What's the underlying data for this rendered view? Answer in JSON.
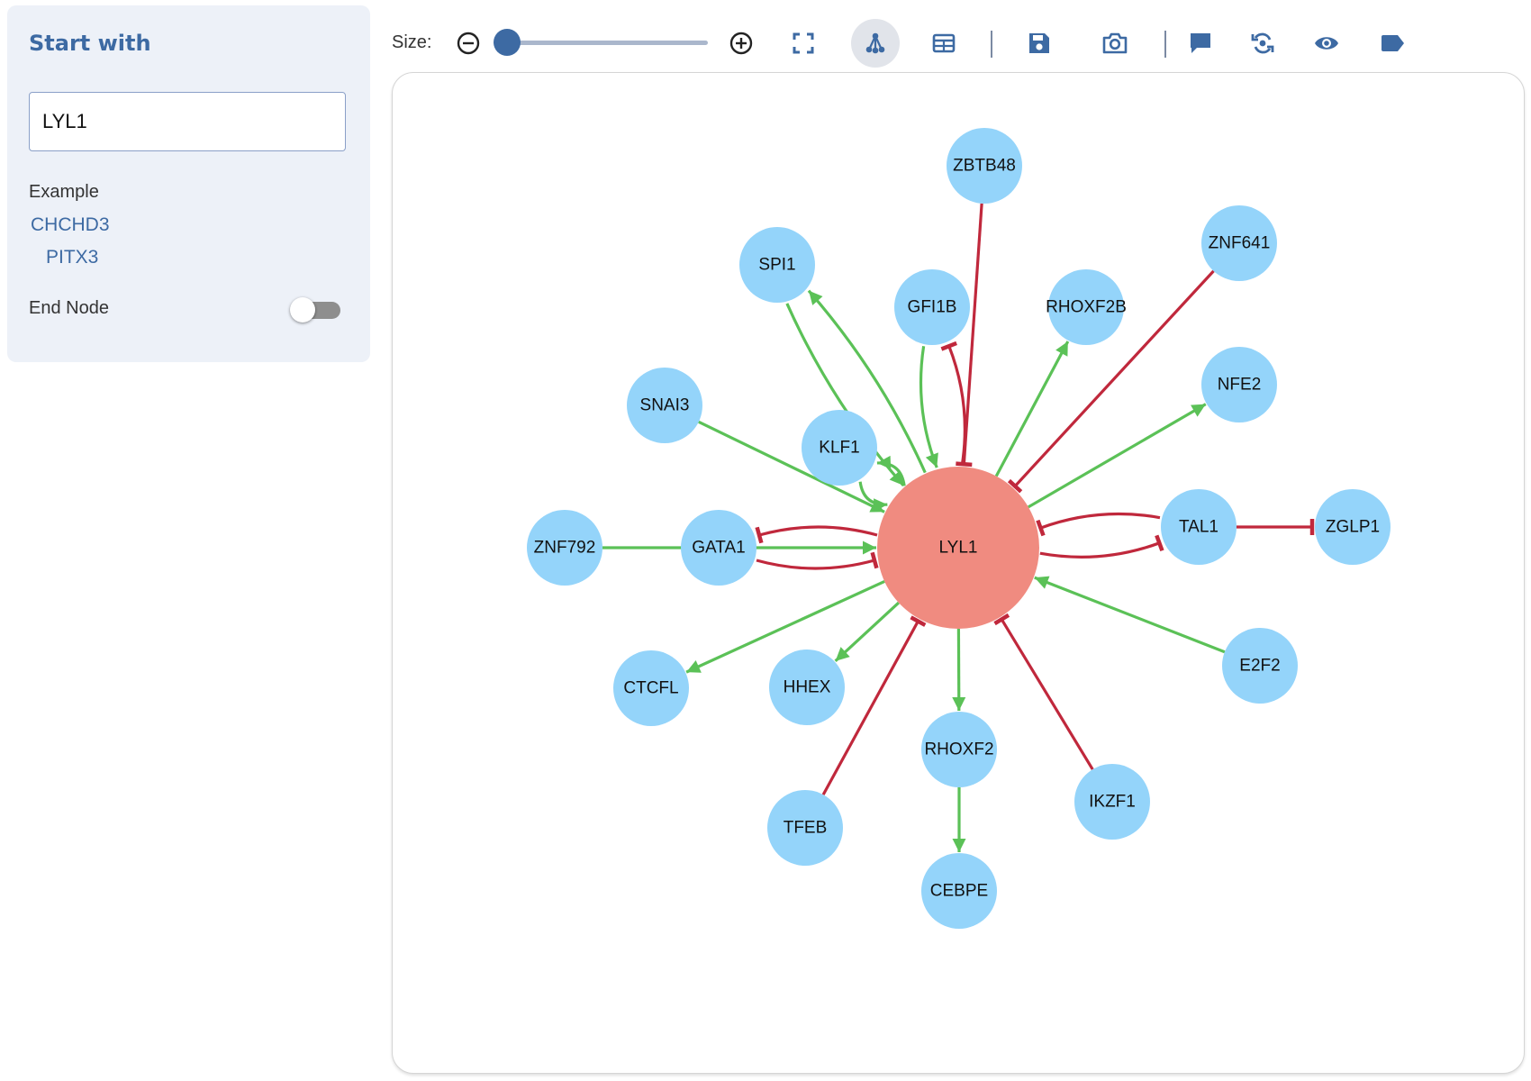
{
  "sidebar": {
    "title": "Start with",
    "search_value": "LYL1",
    "example_label": "Example",
    "examples": [
      "CHCHD3",
      "PITX3"
    ],
    "end_node_label": "End Node",
    "end_node_on": false
  },
  "toolbar": {
    "size_label": "Size:",
    "size_level": 0,
    "icons": [
      "zoom-out-icon",
      "zoom-in-icon",
      "fullscreen-icon",
      "network-layout-icon",
      "table-icon",
      "save-icon",
      "camera-icon",
      "comment-icon",
      "refresh-icon",
      "eye-icon",
      "label-icon"
    ]
  },
  "colors": {
    "accent": "#3d6aa3",
    "node": "#94d4fa",
    "center_node": "#f08b80",
    "activation": "#5bc157",
    "inhibition": "#c0283c"
  },
  "network": {
    "center": "LYL1",
    "nodes": [
      "LYL1",
      "ZBTB48",
      "ZNF641",
      "SPI1",
      "GFI1B",
      "RHOXF2B",
      "NFE2",
      "SNAI3",
      "KLF1",
      "ZNF792",
      "GATA1",
      "TAL1",
      "ZGLP1",
      "CTCFL",
      "HHEX",
      "E2F2",
      "RHOXF2",
      "IKZF1",
      "TFEB",
      "CEBPE"
    ],
    "edges": [
      {
        "source": "ZBTB48",
        "target": "LYL1",
        "type": "inhibition"
      },
      {
        "source": "ZNF641",
        "target": "LYL1",
        "type": "inhibition"
      },
      {
        "source": "SPI1",
        "target": "LYL1",
        "type": "activation"
      },
      {
        "source": "LYL1",
        "target": "SPI1",
        "type": "activation"
      },
      {
        "source": "GFI1B",
        "target": "LYL1",
        "type": "activation"
      },
      {
        "source": "LYL1",
        "target": "GFI1B",
        "type": "inhibition"
      },
      {
        "source": "LYL1",
        "target": "RHOXF2B",
        "type": "activation"
      },
      {
        "source": "LYL1",
        "target": "NFE2",
        "type": "activation"
      },
      {
        "source": "SNAI3",
        "target": "LYL1",
        "type": "activation"
      },
      {
        "source": "KLF1",
        "target": "LYL1",
        "type": "activation"
      },
      {
        "source": "LYL1",
        "target": "KLF1",
        "type": "activation"
      },
      {
        "source": "ZNF792",
        "target": "LYL1",
        "type": "activation"
      },
      {
        "source": "GATA1",
        "target": "LYL1",
        "type": "inhibition"
      },
      {
        "source": "LYL1",
        "target": "GATA1",
        "type": "inhibition"
      },
      {
        "source": "TAL1",
        "target": "LYL1",
        "type": "inhibition"
      },
      {
        "source": "LYL1",
        "target": "TAL1",
        "type": "inhibition"
      },
      {
        "source": "TAL1",
        "target": "ZGLP1",
        "type": "inhibition"
      },
      {
        "source": "LYL1",
        "target": "CTCFL",
        "type": "activation"
      },
      {
        "source": "LYL1",
        "target": "HHEX",
        "type": "activation"
      },
      {
        "source": "E2F2",
        "target": "LYL1",
        "type": "activation"
      },
      {
        "source": "LYL1",
        "target": "RHOXF2",
        "type": "activation"
      },
      {
        "source": "RHOXF2",
        "target": "CEBPE",
        "type": "activation"
      },
      {
        "source": "IKZF1",
        "target": "LYL1",
        "type": "inhibition"
      },
      {
        "source": "TFEB",
        "target": "LYL1",
        "type": "inhibition"
      }
    ]
  }
}
